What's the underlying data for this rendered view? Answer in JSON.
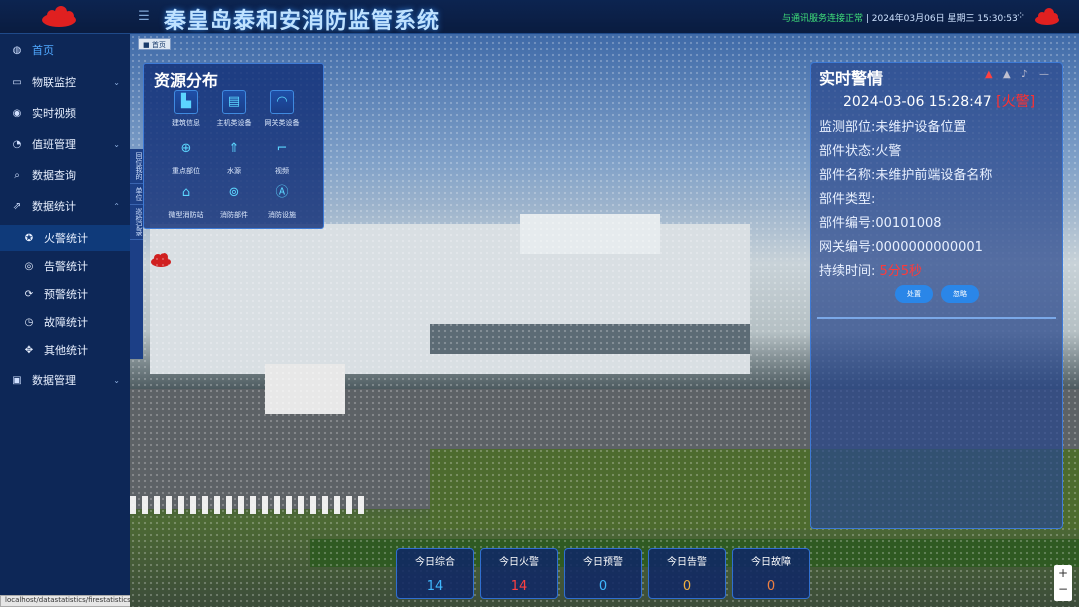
{
  "header": {
    "title": "秦皇岛泰和安消防监管系统",
    "status_ok": "与通讯服务连接正常",
    "status_time": " | 2024年03月06日 星期三 15:30:53"
  },
  "sidebar": {
    "items": [
      {
        "label": "首页",
        "icon": "palette-icon"
      },
      {
        "label": "物联监控",
        "icon": "monitor-icon"
      },
      {
        "label": "实时视频",
        "icon": "eye-icon"
      },
      {
        "label": "值班管理",
        "icon": "clock-icon"
      },
      {
        "label": "数据查询",
        "icon": "search-icon"
      },
      {
        "label": "数据统计",
        "icon": "external-link-icon"
      },
      {
        "label": "数据管理",
        "icon": "image-icon"
      }
    ],
    "sub_items": [
      {
        "label": "火警统计",
        "icon": "fire-stat-icon"
      },
      {
        "label": "告警统计",
        "icon": "alert-stat-icon"
      },
      {
        "label": "预警统计",
        "icon": "warning-stat-icon"
      },
      {
        "label": "故障统计",
        "icon": "fault-stat-icon"
      },
      {
        "label": "其他统计",
        "icon": "other-stat-icon"
      }
    ],
    "url_status": "localhost/datastatistics/firestatistics"
  },
  "breadcrumb": "■ 首页",
  "resource_panel": {
    "title": "资源分布",
    "items": [
      {
        "label": "建筑信息",
        "icon": "building-icon"
      },
      {
        "label": "主机类设备",
        "icon": "host-device-icon"
      },
      {
        "label": "网关类设备",
        "icon": "gateway-icon"
      },
      {
        "label": "重点部位",
        "icon": "target-icon"
      },
      {
        "label": "水源",
        "icon": "water-icon"
      },
      {
        "label": "视频",
        "icon": "camera-icon"
      },
      {
        "label": "微型消防站",
        "icon": "fire-station-icon"
      },
      {
        "label": "消防部件",
        "icon": "fire-part-icon"
      },
      {
        "label": "消防设施",
        "icon": "extinguisher-icon"
      }
    ]
  },
  "side_tabs": [
    "回位我的",
    "单位",
    "巡检记录"
  ],
  "alarm_panel": {
    "title": "实时警情",
    "timestamp": "2024-03-06 15:28:47",
    "tag": "[火警]",
    "location": "监测部位:未维护设备位置",
    "state": "部件状态:火警",
    "part_name": "部件名称:未维护前端设备名称",
    "part_type": "部件类型:",
    "part_no": "部件编号:00101008",
    "gateway_no": "网关编号:0000000000001",
    "duration_label": "持续时间: ",
    "duration_value": "5分5秒",
    "handle_label": "处置",
    "ignore_label": "忽略"
  },
  "stats": [
    {
      "label": "今日综合",
      "value": "14",
      "color": "#3fb8ff"
    },
    {
      "label": "今日火警",
      "value": "14",
      "color": "#ff4040"
    },
    {
      "label": "今日预警",
      "value": "0",
      "color": "#3fb8ff"
    },
    {
      "label": "今日告警",
      "value": "0",
      "color": "#f0b040"
    },
    {
      "label": "今日故障",
      "value": "0",
      "color": "#f08040"
    }
  ],
  "colors": {
    "accent": "#2a86e8",
    "alarm": "#ff3030",
    "sidebar": "#0d2757"
  }
}
